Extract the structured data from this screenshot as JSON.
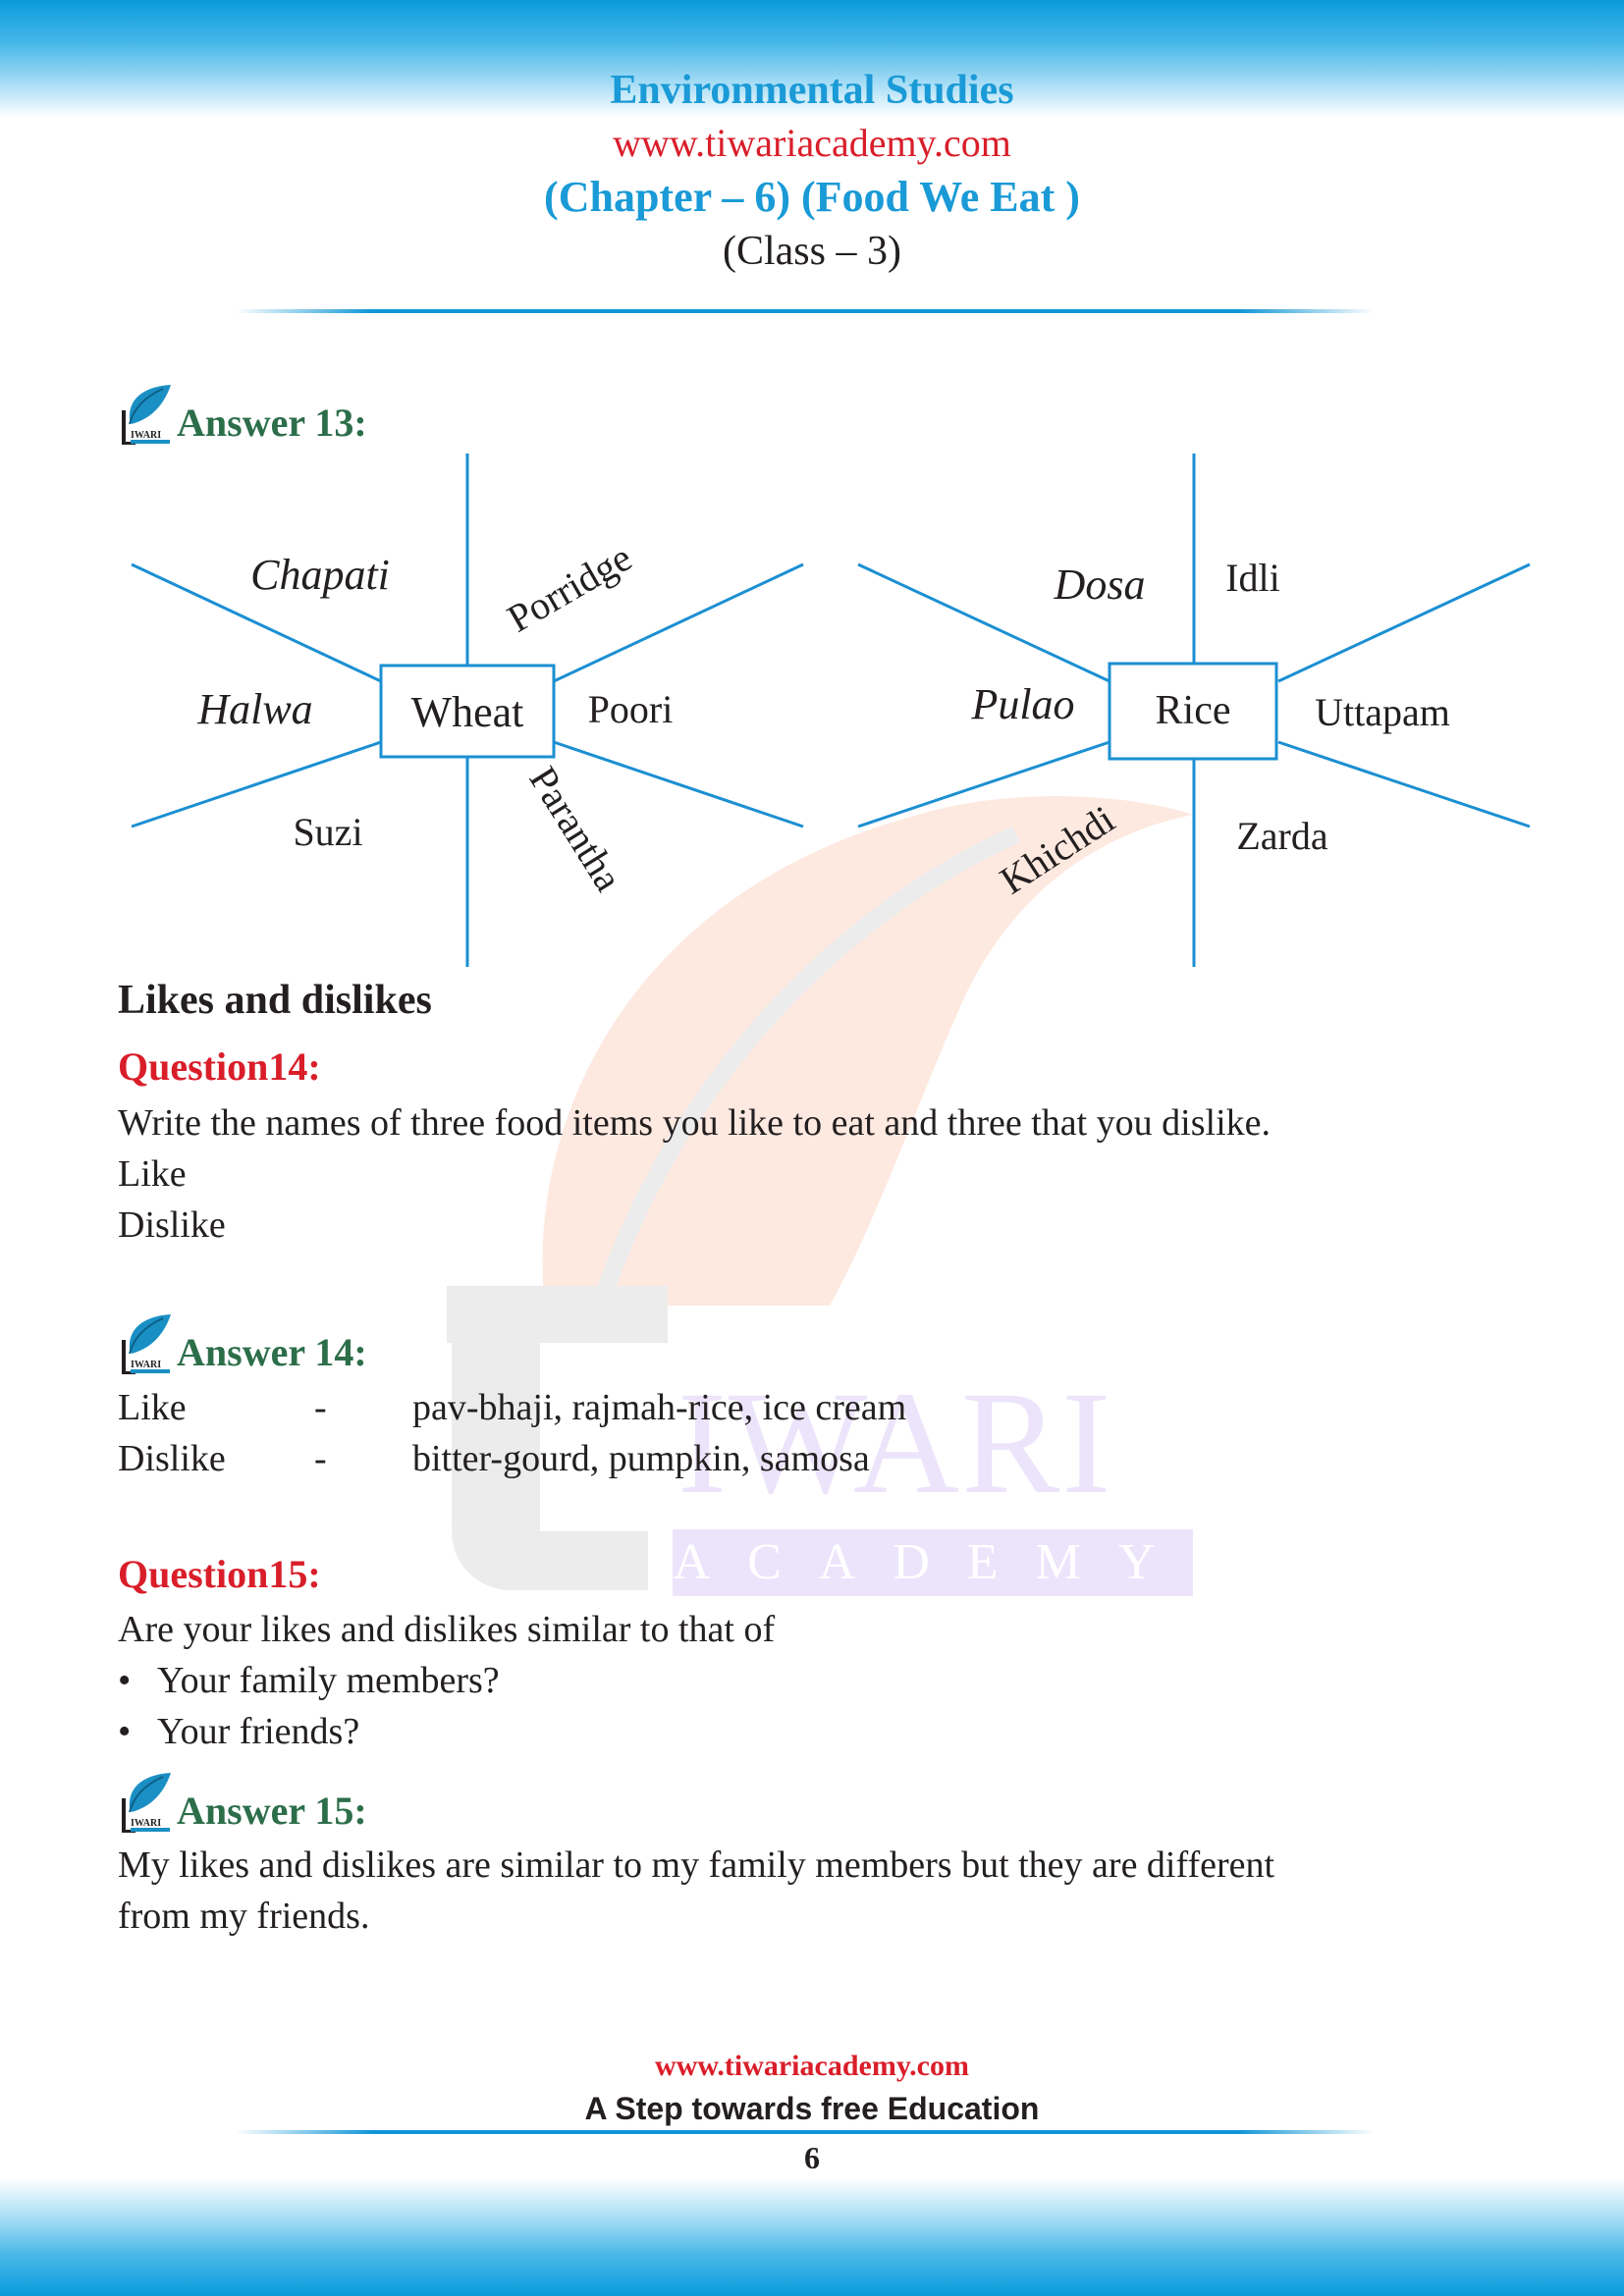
{
  "header": {
    "subject": "Environmental Studies",
    "website": "www.tiwariacademy.com",
    "chapter": "(Chapter – 6) (Food We Eat )",
    "class": "(Class – 3)"
  },
  "watermark": {
    "brand_main": "IWARI",
    "brand_sub": "ACADEMY",
    "brand_initial": "t"
  },
  "logo": {
    "icon": "tiwari-leaf-logo-icon",
    "text": "IWARI"
  },
  "answer13": {
    "heading": "Answer 13:",
    "diagrams": [
      {
        "center": "Wheat",
        "items": [
          "Chapati",
          "Porridge",
          "Halwa",
          "Poori",
          "Suzi",
          "Parantha"
        ]
      },
      {
        "center": "Rice",
        "items": [
          "Dosa",
          "Idli",
          "Pulao",
          "Uttapam",
          "Khichdi",
          "Zarda"
        ]
      }
    ]
  },
  "section": {
    "title": "Likes and dislikes"
  },
  "question14": {
    "heading": "Question14:",
    "text": "Write the names of three food items you like to eat and three that you dislike.",
    "line1": "Like",
    "line2": "Dislike"
  },
  "answer14": {
    "heading": "Answer 14:",
    "rows": [
      {
        "label": "Like",
        "sep": "-",
        "value": "pav-bhaji, rajmah-rice, ice cream"
      },
      {
        "label": "Dislike",
        "sep": "-",
        "value": "bitter-gourd, pumpkin, samosa"
      }
    ]
  },
  "question15": {
    "heading": "Question15:",
    "text": "Are your likes and dislikes similar to that of",
    "bullets": [
      "Your family members?",
      "Your friends?"
    ],
    "bullet_glyph": "•"
  },
  "answer15": {
    "heading": "Answer 15:",
    "line1": "My likes and dislikes are similar to my family members but they are different",
    "line2": "from my friends."
  },
  "footer": {
    "website": "www.tiwariacademy.com",
    "tagline": "A Step towards free Education",
    "page_number": "6"
  },
  "colors": {
    "brand_blue": "#1a9ad6",
    "brand_red": "#d91e2a",
    "answer_green": "#2d6e4a",
    "diagram_line": "#1b8fd2"
  }
}
